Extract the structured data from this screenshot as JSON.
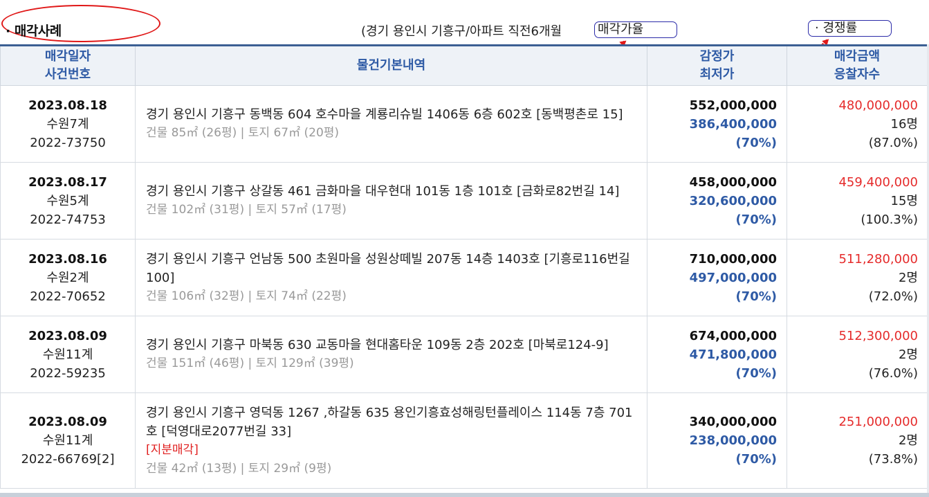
{
  "header": {
    "title": "매각사례",
    "summary": "(경기 용인시 기흥구/아파트 직전6개월",
    "rate_button": "매각가율",
    "competition_button": "· 경쟁률"
  },
  "columns": {
    "date": [
      "매각일자",
      "사건번호"
    ],
    "info": "물건기본내역",
    "price": [
      "감정가",
      "최저가"
    ],
    "sale": [
      "매각금액",
      "응찰자수"
    ]
  },
  "rows": [
    {
      "date": "2023.08.18",
      "court": "수원7계",
      "case": "2022-73750",
      "address": "경기 용인시 기흥구 동백동 604 호수마을 계룡리슈빌 1406동 6층 602호 [동백평촌로 15]",
      "tag": "",
      "area": "건물 85㎡ (26평) | 토지 67㎡ (20평)",
      "appraisal": "552,000,000",
      "minimum": "386,400,000",
      "min_pct": "(70%)",
      "sale_amount": "480,000,000",
      "bidders": "16명",
      "sale_rate": "(87.0%)"
    },
    {
      "date": "2023.08.17",
      "court": "수원5계",
      "case": "2022-74753",
      "address": "경기 용인시 기흥구 상갈동 461 금화마을 대우현대 101동 1층 101호 [금화로82번길 14]",
      "tag": "",
      "area": "건물 102㎡ (31평) | 토지 57㎡ (17평)",
      "appraisal": "458,000,000",
      "minimum": "320,600,000",
      "min_pct": "(70%)",
      "sale_amount": "459,400,000",
      "bidders": "15명",
      "sale_rate": "(100.3%)"
    },
    {
      "date": "2023.08.16",
      "court": "수원2계",
      "case": "2022-70652",
      "address": "경기 용인시 기흥구 언남동 500 초원마을 성원상떼빌 207동 14층 1403호 [기흥로116번길 100]",
      "tag": "",
      "area": "건물 106㎡ (32평) | 토지 74㎡ (22평)",
      "appraisal": "710,000,000",
      "minimum": "497,000,000",
      "min_pct": "(70%)",
      "sale_amount": "511,280,000",
      "bidders": "2명",
      "sale_rate": "(72.0%)"
    },
    {
      "date": "2023.08.09",
      "court": "수원11계",
      "case": "2022-59235",
      "address": "경기 용인시 기흥구 마북동 630 교동마을 현대홈타운 109동 2층 202호 [마북로124-9]",
      "tag": "",
      "area": "건물 151㎡ (46평) | 토지 129㎡ (39평)",
      "appraisal": "674,000,000",
      "minimum": "471,800,000",
      "min_pct": "(70%)",
      "sale_amount": "512,300,000",
      "bidders": "2명",
      "sale_rate": "(76.0%)"
    },
    {
      "date": "2023.08.09",
      "court": "수원11계",
      "case": "2022-66769[2]",
      "address": "경기 용인시 기흥구 영덕동 1267 ,하갈동 635 용인기흥효성해링턴플레이스 114동 7층 701호 [덕영대로2077번길 33]",
      "tag": "[지분매각]",
      "area": "건물 42㎡ (13평) | 토지 29㎡ (9평)",
      "appraisal": "340,000,000",
      "minimum": "238,000,000",
      "min_pct": "(70%)",
      "sale_amount": "251,000,000",
      "bidders": "2명",
      "sale_rate": "(73.8%)"
    }
  ],
  "colors": {
    "accent_blue": "#2e5aa5",
    "sale_red": "#e52b2b",
    "annotation_red": "#e01818",
    "header_bg": "#eef2f7"
  }
}
